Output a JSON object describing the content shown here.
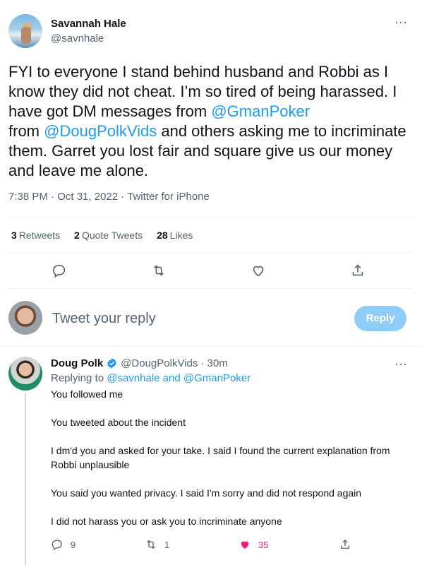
{
  "tweet": {
    "author_name": "Savannah Hale",
    "author_handle": "@savnhale",
    "text_parts": [
      "FYI to everyone I stand behind husband and Robbi as I know they did not cheat. I’m so tired of being harassed. I have got DM messages from ",
      "@GmanPoker",
      "\nfrom ",
      "@DougPolkVids",
      " and others asking me to incriminate them. Garret you lost fair and square give us our money and leave me alone."
    ],
    "meta": "7:38 PM · Oct 31, 2022 · Twitter for iPhone",
    "stats": {
      "retweets_count": "3",
      "retweets_label": "Retweets",
      "quotes_count": "2",
      "quotes_label": "Quote Tweets",
      "likes_count": "28",
      "likes_label": "Likes"
    },
    "icons": [
      "reply-icon",
      "retweet-icon",
      "like-icon",
      "share-icon"
    ]
  },
  "composer": {
    "placeholder": "Tweet your reply",
    "button_label": "Reply"
  },
  "reply": {
    "author_name": "Doug Polk",
    "author_handle": "@DougPolkVids",
    "time": "· 30m",
    "replying_prefix": "Replying to ",
    "replying_to_1": "@savnhale",
    "replying_and": " and ",
    "replying_to_2": "@GmanPoker",
    "lines": [
      "You followed me",
      "You tweeted about the incident",
      "I dm'd you and asked for your take. I said I found the current explanation from Robbi unplausible",
      "You said you wanted privacy. I said I'm sorry and did not respond again",
      "I did not harass you or ask you to incriminate anyone"
    ],
    "reply_count": "9",
    "retweet_count": "1",
    "like_count": "35"
  },
  "colors": {
    "accent": "#1d9bf0",
    "muted": "#536471",
    "like": "#f91880"
  }
}
